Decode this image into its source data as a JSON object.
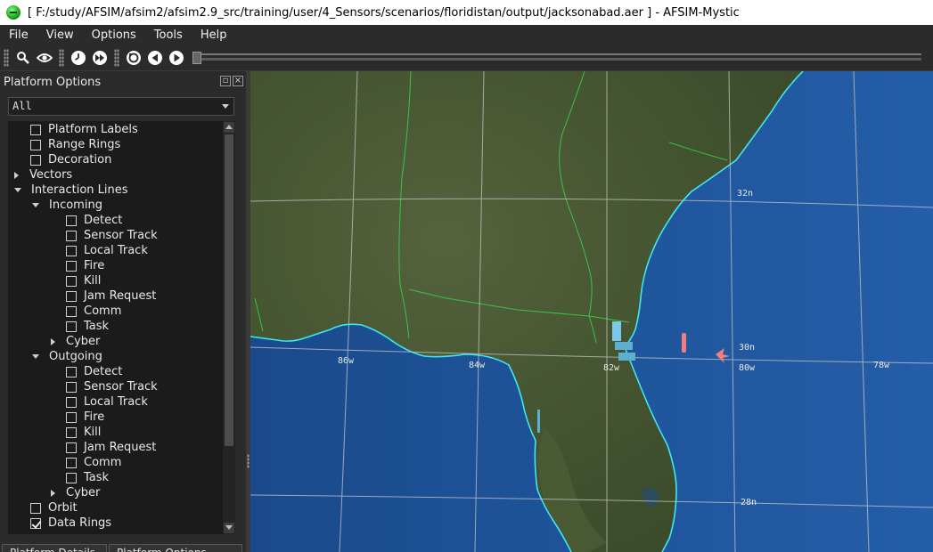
{
  "window": {
    "title": "[ F:/study/AFSIM/afsim2/afsim2.9_src/training/user/4_Sensors/scenarios/floridistan/output/jacksonabad.aer ] - AFSIM-Mystic"
  },
  "menu": [
    "File",
    "View",
    "Options",
    "Tools",
    "Help"
  ],
  "toolbar": {
    "icons": [
      "search-icon",
      "eye-icon",
      "clock-icon",
      "fast-forward-icon",
      "restart-icon",
      "play-reverse-icon",
      "play-icon"
    ]
  },
  "panel": {
    "title": "Platform Options",
    "filter": "All",
    "tree": [
      {
        "label": "Platform Labels",
        "type": "checkbox",
        "checked": false,
        "indent": 0
      },
      {
        "label": "Range Rings",
        "type": "checkbox",
        "checked": false,
        "indent": 0
      },
      {
        "label": "Decoration",
        "type": "checkbox",
        "checked": false,
        "indent": 0
      },
      {
        "label": "Vectors",
        "type": "collapsed",
        "indent": 0
      },
      {
        "label": "Interaction Lines",
        "type": "expanded",
        "indent": 0
      },
      {
        "label": "Incoming",
        "type": "expanded",
        "indent": 1
      },
      {
        "label": "Detect",
        "type": "checkbox",
        "checked": false,
        "indent": 2
      },
      {
        "label": "Sensor Track",
        "type": "checkbox",
        "checked": false,
        "indent": 2
      },
      {
        "label": "Local Track",
        "type": "checkbox",
        "checked": false,
        "indent": 2
      },
      {
        "label": "Fire",
        "type": "checkbox",
        "checked": false,
        "indent": 2
      },
      {
        "label": "Kill",
        "type": "checkbox",
        "checked": false,
        "indent": 2
      },
      {
        "label": "Jam Request",
        "type": "checkbox",
        "checked": false,
        "indent": 2
      },
      {
        "label": "Comm",
        "type": "checkbox",
        "checked": false,
        "indent": 2
      },
      {
        "label": "Task",
        "type": "checkbox",
        "checked": false,
        "indent": 2
      },
      {
        "label": "Cyber",
        "type": "collapsed",
        "indent": 1
      },
      {
        "label": "Outgoing",
        "type": "expanded",
        "indent": 1
      },
      {
        "label": "Detect",
        "type": "checkbox",
        "checked": false,
        "indent": 2
      },
      {
        "label": "Sensor Track",
        "type": "checkbox",
        "checked": false,
        "indent": 2
      },
      {
        "label": "Local Track",
        "type": "checkbox",
        "checked": false,
        "indent": 2
      },
      {
        "label": "Fire",
        "type": "checkbox",
        "checked": false,
        "indent": 2
      },
      {
        "label": "Kill",
        "type": "checkbox",
        "checked": false,
        "indent": 2
      },
      {
        "label": "Jam Request",
        "type": "checkbox",
        "checked": false,
        "indent": 2
      },
      {
        "label": "Comm",
        "type": "checkbox",
        "checked": false,
        "indent": 2
      },
      {
        "label": "Task",
        "type": "checkbox",
        "checked": false,
        "indent": 2
      },
      {
        "label": "Cyber",
        "type": "collapsed",
        "indent": 1
      },
      {
        "label": "Orbit",
        "type": "checkbox",
        "checked": false,
        "indent": 0
      },
      {
        "label": "Data Rings",
        "type": "checkbox",
        "checked": true,
        "indent": 0
      }
    ],
    "bottom_tabs": [
      "Platform Details",
      "Platform Options"
    ]
  },
  "map": {
    "latitude_labels": [
      "32n",
      "30n",
      "28n"
    ],
    "longitude_labels": [
      "86w",
      "84w",
      "82w",
      "80w",
      "78w"
    ],
    "colors": {
      "ocean": "#1c4f93",
      "land": "#4a5a35",
      "coastline": "#3ee8f0",
      "borders": "#33d04a",
      "grid": "#c8c8c8",
      "friendly": "#7cc8ea",
      "hostile": "#f08080"
    }
  }
}
